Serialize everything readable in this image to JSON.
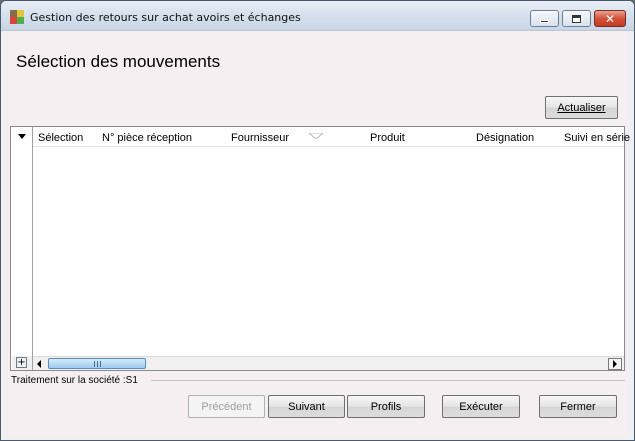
{
  "window": {
    "title": "Gestion des retours sur achat avoirs et échanges",
    "icon": "app-color-grid-icon",
    "controls": {
      "minimize": "minimize-icon",
      "maximize": "maximize-icon",
      "close": "✕"
    }
  },
  "page": {
    "heading": "Sélection des mouvements",
    "refresh_label": "Actualiser"
  },
  "grid": {
    "columns": [
      "Sélection",
      "N° pièce réception",
      "Fournisseur",
      "Produit",
      "Désignation",
      "Suivi en série"
    ],
    "rows": [],
    "expand_glyph": "+"
  },
  "footer": {
    "company_label": "Traitement sur la société :S1",
    "buttons": {
      "previous": "Précédent",
      "next": "Suivant",
      "profiles": "Profils",
      "execute": "Exécuter",
      "close": "Fermer"
    }
  },
  "colors": {
    "client_background": "#f5eff2",
    "title_bar": "#d7e1ee",
    "close_button": "#c23a24",
    "scroll_thumb": "#9ec9ef"
  }
}
